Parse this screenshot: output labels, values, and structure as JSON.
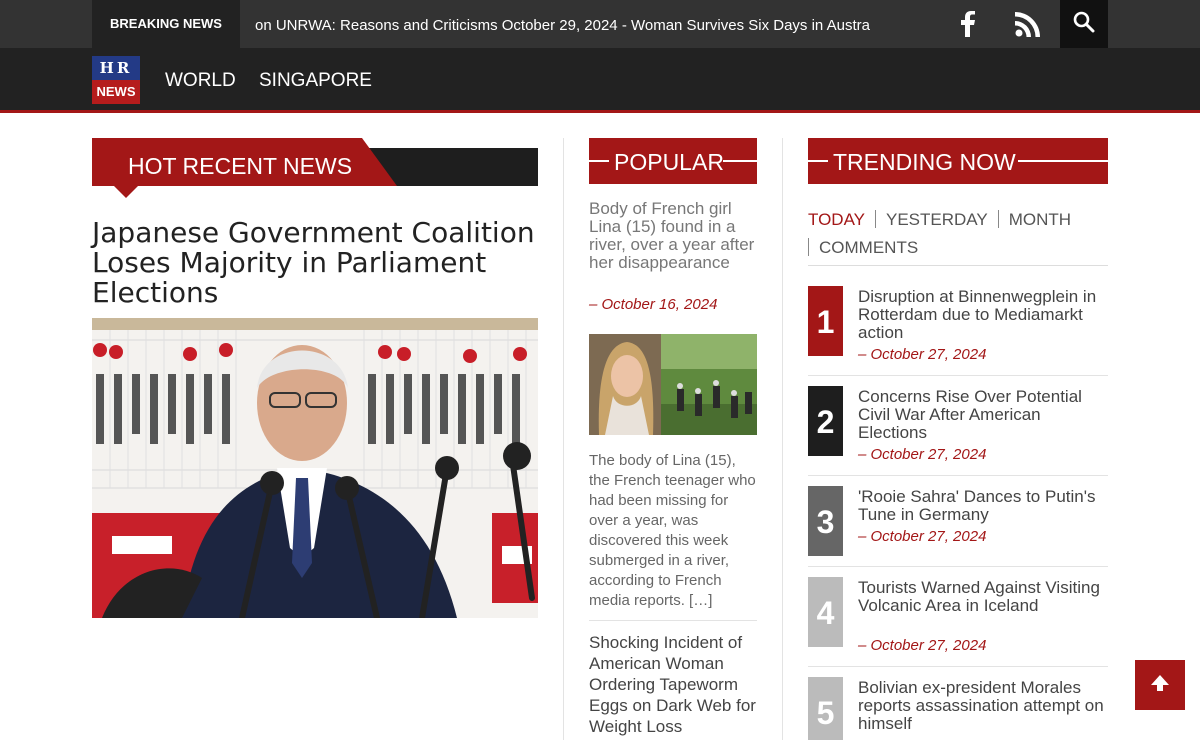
{
  "header": {
    "breaking_label": "BREAKING NEWS",
    "ticker_text": "on UNRWA: Reasons and Criticisms October 29, 2024 - Woman Survives Six Days in Austra",
    "logo_top": "HR",
    "logo_bottom": "NEWS",
    "icons": [
      "facebook-icon",
      "rss-icon",
      "search-icon"
    ]
  },
  "nav": {
    "items": [
      {
        "label": "WORLD"
      },
      {
        "label": "SINGAPORE"
      }
    ]
  },
  "hot_news": {
    "section_title": "HOT RECENT NEWS",
    "headline": "Japanese Government Coalition Loses Majority in Parliament Elections"
  },
  "popular": {
    "section_title": "POPULAR",
    "article1": {
      "title": "Body of French girl Lina (15) found in a river, over a year after her disappearance",
      "date": "– October 16, 2024",
      "excerpt": "The body of Lina (15), the French teenager who had been missing for over a year, was discovered this week submerged in a river, according to French media reports. […]"
    },
    "article2": {
      "title": "Shocking Incident of American Woman Ordering Tapeworm Eggs on Dark Web for Weight Loss"
    }
  },
  "trending": {
    "section_title": "TRENDING NOW",
    "tabs": [
      {
        "label": "TODAY"
      },
      {
        "label": "YESTERDAY"
      },
      {
        "label": "MONTH"
      },
      {
        "label": "COMMENTS"
      }
    ],
    "items": [
      {
        "rank": "1",
        "title": "Disruption at Binnenwegplein in Rotterdam due to Mediamarkt action",
        "date": "– October 27, 2024",
        "color": "#a31717"
      },
      {
        "rank": "2",
        "title": "Concerns Rise Over Potential Civil War After American Elections",
        "date": "– October 27, 2024",
        "color": "#1e1e1e"
      },
      {
        "rank": "3",
        "title": "'Rooie Sahra' Dances to Putin's Tune in Germany",
        "date": "– October 27, 2024",
        "color": "#666666"
      },
      {
        "rank": "4",
        "title": "Tourists Warned Against Visiting Volcanic Area in Iceland",
        "date": "– October 27, 2024",
        "color": "#bbbbbb"
      },
      {
        "rank": "5",
        "title": "Bolivian ex-president Morales reports assassination attempt on himself",
        "date": "",
        "color": "#bbbbbb"
      }
    ]
  },
  "colors": {
    "accent_red": "#a31717",
    "topbar": "#333333",
    "navbar": "#222222"
  },
  "back_to_top_icon": "arrow-up-icon"
}
